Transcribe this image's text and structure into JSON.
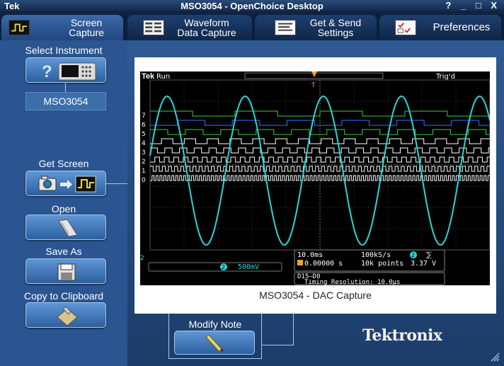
{
  "window": {
    "brand": "Tek",
    "title": "MSO3054 - OpenChoice Desktop",
    "controls": [
      "?",
      "_",
      "□",
      "X"
    ]
  },
  "tabs": [
    {
      "line1": "Screen",
      "line2": "Capture",
      "icon": "screen-capture-icon",
      "active": true
    },
    {
      "line1": "Waveform",
      "line2": "Data Capture",
      "icon": "waveform-data-icon",
      "active": false
    },
    {
      "line1": "Get & Send",
      "line2": "Settings",
      "icon": "settings-doc-icon",
      "active": false
    },
    {
      "line1": "Preferences",
      "line2": "",
      "icon": "preferences-checklist-icon",
      "active": false
    }
  ],
  "left_panel": {
    "select_instrument_label": "Select Instrument",
    "instrument_name": "MSO3054",
    "get_screen_label": "Get Screen",
    "open_label": "Open",
    "save_as_label": "Save As",
    "copy_label": "Copy to Clipboard"
  },
  "capture": {
    "caption": "MSO3054 - DAC Capture",
    "scope": {
      "brand": "Tek",
      "run_state": "Run",
      "trigger_state": "Trig'd",
      "trigger_marker": "T",
      "channel2_scale": "500mV",
      "timebase": "10.0ms",
      "sample_rate": "100kS/s",
      "trigger_channel": "2",
      "trigger_level": "3.37 V",
      "trigger_position": "0.00000 s",
      "record_length": "10k points",
      "digital_range": "D15–D0",
      "timing_resolution": "Timing Resolution: 10.0µs",
      "digital_labels": [
        "7",
        "6",
        "5",
        "4",
        "3",
        "2",
        "1",
        "0"
      ],
      "colors": {
        "analog": "#2ad6d6",
        "digital_high": "#3ad03a",
        "digital_low": "#3a72ff",
        "grid": "#3a3a3a"
      }
    }
  },
  "note": {
    "label": "Modify Note"
  },
  "brand_logo": "Tektronix",
  "colors": {
    "accent": "#5f97d6",
    "panel": "#2a5590",
    "titlebar": "#10264a"
  }
}
